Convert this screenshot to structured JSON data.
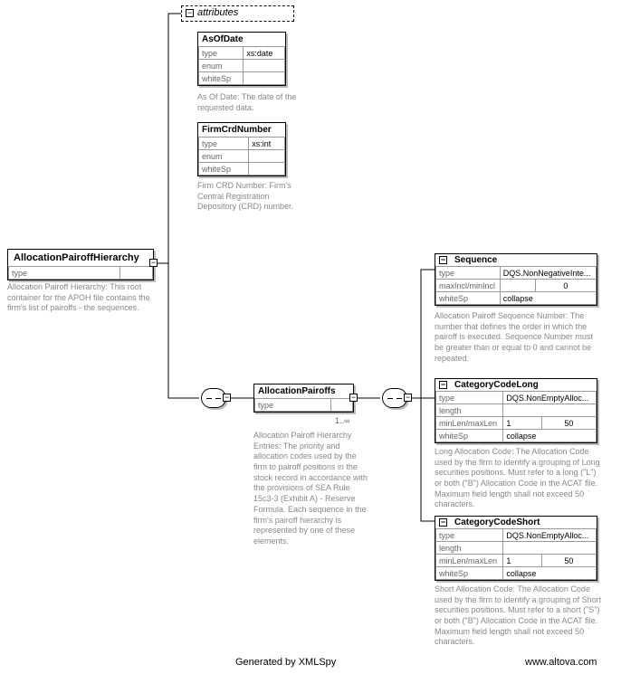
{
  "root": {
    "name": "AllocationPairoffHierarchy",
    "rows": [
      [
        "type",
        ""
      ]
    ],
    "desc": "Allocation Pairoff Hierarchy: This root container for the APOH file contains the firm's list of pairoffs - the sequences."
  },
  "attributes": {
    "label": "attributes",
    "as_of_date": {
      "name": "AsOfDate",
      "rows": [
        [
          "type",
          "xs:date"
        ],
        [
          "enum",
          ""
        ],
        [
          "whiteSp",
          ""
        ]
      ],
      "desc": "As Of Date: The date of the requested data."
    },
    "firm_crd": {
      "name": "FirmCrdNumber",
      "rows": [
        [
          "type",
          "xs:int"
        ],
        [
          "enum",
          ""
        ],
        [
          "whiteSp",
          ""
        ]
      ],
      "desc": "Firm CRD Number: Firm's Central Registration Depository (CRD) number."
    }
  },
  "pairoffs": {
    "name": "AllocationPairoffs",
    "rows": [
      [
        "type",
        ""
      ]
    ],
    "cardinality": "1..∞",
    "desc": "Allocation Pairoff Hierarchy Entries: The priority and allocation codes used by the firm to pairoff positions in the stock record in accordance with the provisions of SEA Rule 15c3-3 (Exhibit A) - Reserve Formula. Each sequence in the firm's pairoff hierarchy is represented by one of these elements."
  },
  "sequence": {
    "name": "Sequence",
    "rows": [
      [
        "type",
        "DQS.NonNegativeInte..."
      ],
      [
        "maxIncl/minIncl",
        "",
        "0"
      ],
      [
        "whiteSp",
        "collapse"
      ]
    ],
    "desc": "Allocation Pairoff Sequence Number: The number that defines the order in which the pairoff is executed. Sequence Number must be greater than or equal to 0 and cannot be repeated."
  },
  "cat_long": {
    "name": "CategoryCodeLong",
    "rows": [
      [
        "type",
        "DQS.NonEmptyAlloc..."
      ],
      [
        "length",
        ""
      ],
      [
        "minLen/maxLen",
        "1",
        "50"
      ],
      [
        "whiteSp",
        "collapse"
      ]
    ],
    "desc": "Long Allocation Code: The Allocation Code used by the firm to identify a grouping of Long securities positions. Must refer to a long (\"L\") or both (\"B\") Allocation Code in the ACAT file. Maximum field length shall not exceed 50 characters."
  },
  "cat_short": {
    "name": "CategoryCodeShort",
    "rows": [
      [
        "type",
        "DQS.NonEmptyAlloc..."
      ],
      [
        "length",
        ""
      ],
      [
        "minLen/maxLen",
        "1",
        "50"
      ],
      [
        "whiteSp",
        "collapse"
      ]
    ],
    "desc": "Short Allocation Code: The Allocation Code used by the firm to identify a grouping of Short securities positions. Must refer to a short (\"S\") or both (\"B\") Allocation Code in the ACAT file. Maximum field length shall not exceed 50 characters."
  },
  "footer": {
    "left": "Generated by XMLSpy",
    "right": "www.altova.com"
  }
}
